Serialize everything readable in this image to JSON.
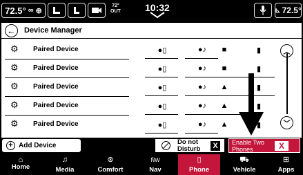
{
  "status_bar": {
    "left_temp": "72.5°",
    "left_temp_icons": "steering-wheel-heat-icon, fan-icon",
    "outside_temp": "72°",
    "outside_label": "OUT",
    "clock": "10:32",
    "right_temp": "72.5°",
    "right_temp_icon": "seat-heat-icon"
  },
  "header": {
    "title": "Device Manager"
  },
  "devices": [
    {
      "name": "Paired Device",
      "icons": [
        "phone-connected-icon",
        "media-connected-icon",
        "active-square-icon",
        "disconnected-bar-icon"
      ]
    },
    {
      "name": "Paired Device",
      "icons": [
        "phone-connected-icon",
        "media-connected-icon",
        "active-square-icon",
        "disconnected-bar-icon"
      ]
    },
    {
      "name": "Paired Device",
      "icons": [
        "phone-connected-icon",
        "media-connected-icon",
        "triangle-icon",
        "disconnected-bar-icon"
      ]
    },
    {
      "name": "Paired Device",
      "icons": [
        "phone-connected-icon",
        "media-connected-icon",
        "triangle-icon",
        "disconnected-bar-icon"
      ]
    },
    {
      "name": "Paired Device",
      "icons": [
        "phone-connected-icon",
        "media-connected-icon",
        "triangle-icon",
        "disconnected-bar-icon"
      ]
    }
  ],
  "actions": {
    "add_device": "Add Device",
    "do_not_disturb": "Do not Disturb",
    "do_not_disturb_state": "X",
    "enable_two_phones": "Enable Two Phones",
    "enable_two_phones_state": "X"
  },
  "nav": {
    "items": [
      {
        "label": "Home",
        "icon": "home-icon"
      },
      {
        "label": "Media",
        "icon": "music-note-icon"
      },
      {
        "label": "Comfort",
        "icon": "steering-heat-icon"
      },
      {
        "label": "Nav",
        "icon": "compass-icon"
      },
      {
        "label": "Phone",
        "icon": "phone-icon"
      },
      {
        "label": "Vehicle",
        "icon": "car-icon"
      },
      {
        "label": "Apps",
        "icon": "grid-icon"
      }
    ],
    "active": "Phone"
  },
  "colors": {
    "accent": "#c4163a",
    "background": "#000000",
    "panel": "#ffffff"
  }
}
